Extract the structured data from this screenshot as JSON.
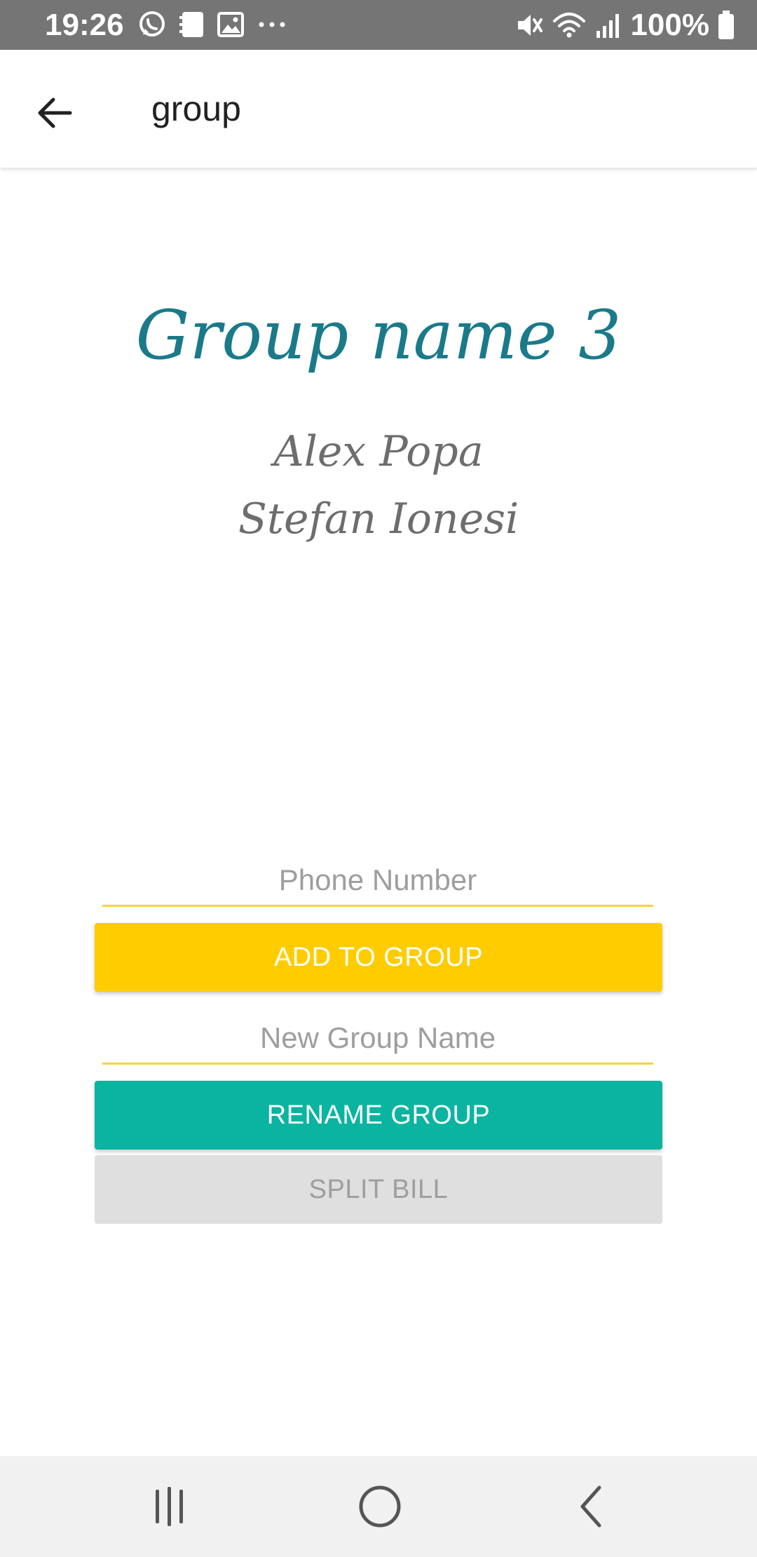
{
  "status_bar": {
    "time": "19:26",
    "battery_text": "100%",
    "icons_left": [
      "whatsapp-icon",
      "notification-icon",
      "gallery-icon",
      "more-dots-icon"
    ],
    "icons_right": [
      "mute-icon",
      "wifi-icon",
      "signal-icon",
      "battery-icon"
    ]
  },
  "app_bar": {
    "title": "group",
    "back_icon": "arrow-left-icon"
  },
  "group": {
    "name": "Group name 3",
    "members": [
      "Alex Popa",
      "Stefan Ionesi"
    ]
  },
  "form": {
    "phone_placeholder": "Phone Number",
    "phone_value": "",
    "add_button_label": "ADD TO GROUP",
    "group_name_placeholder": "New Group Name",
    "group_name_value": "",
    "rename_button_label": "RENAME GROUP",
    "split_button_label": "SPLIT BILL"
  },
  "nav_bar": {
    "buttons": [
      "recents-icon",
      "home-icon",
      "back-icon"
    ]
  },
  "colors": {
    "status_bar": "#757575",
    "title_teal": "#1a7a8a",
    "member_gray": "#6d6d6d",
    "input_underline": "#f7d23e",
    "add_button": "#ffcc00",
    "rename_button": "#0ab4a0",
    "split_button": "#dfdfdf",
    "nav_bar": "#f1f1f1"
  }
}
